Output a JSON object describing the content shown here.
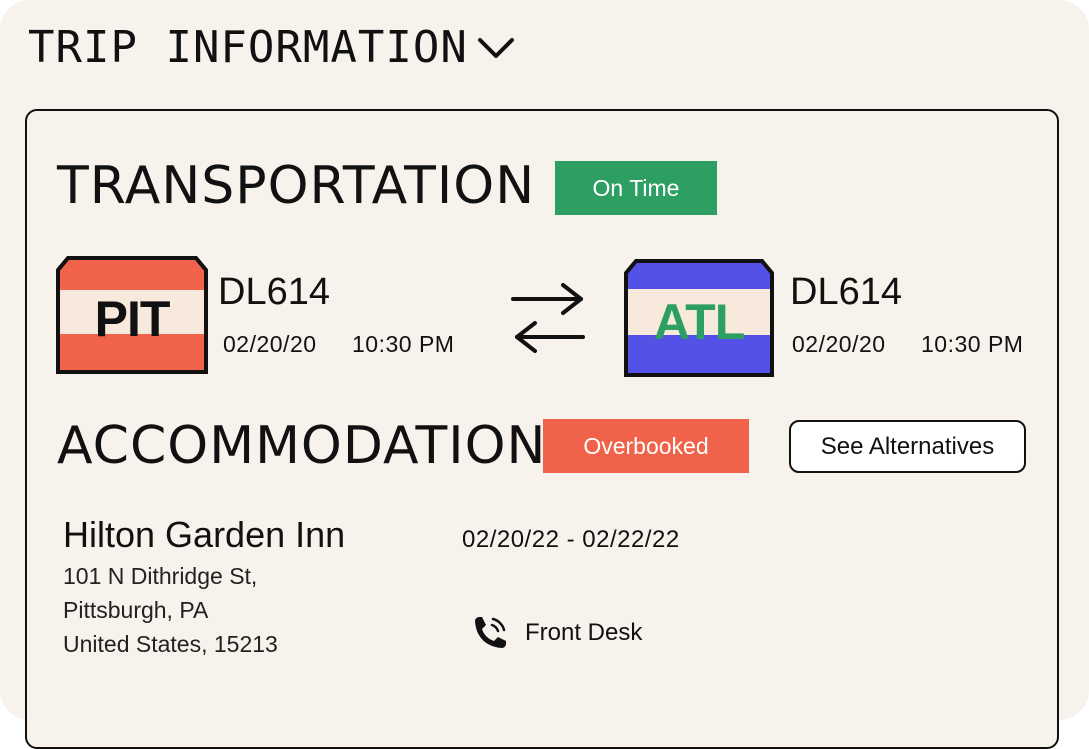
{
  "header": {
    "title": "TRIP INFORMATION",
    "toggle_icon": "chevron-down-icon"
  },
  "transportation": {
    "title": "TRANSPORTATION",
    "status": "On Time",
    "status_color": "#2e9f63",
    "origin": {
      "code": "PIT",
      "flight": "DL614",
      "date": "02/20/20",
      "time": "10:30 PM",
      "stripe_color": "#f0624a",
      "code_color": "#111111"
    },
    "destination": {
      "code": "ATL",
      "flight": "DL614",
      "date": "02/20/20",
      "time": "10:30 PM",
      "stripe_color": "#5451e6",
      "code_color": "#2e9f63"
    },
    "swap_icon": "swap-arrows-icon"
  },
  "accommodation": {
    "title": "ACCOMMODATION",
    "status": "Overbooked",
    "status_color": "#f0624a",
    "alternatives_label": "See Alternatives",
    "hotel_name": "Hilton Garden Inn",
    "address": [
      "101 N Dithridge St,",
      "Pittsburgh, PA",
      "United States, 15213"
    ],
    "dates": "02/20/22 - 02/22/22",
    "contact_label": "Front Desk",
    "contact_icon": "phone-icon"
  }
}
